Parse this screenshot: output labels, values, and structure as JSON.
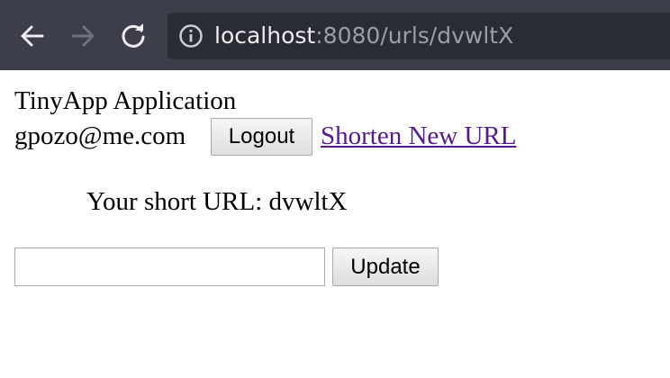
{
  "browser": {
    "url_host": "localhost",
    "url_path": ":8080/urls/dvwltX"
  },
  "page": {
    "title": "TinyApp Application",
    "user_email": "gpozo@me.com",
    "logout_label": "Logout",
    "shorten_link_label": "Shorten New URL",
    "short_url_text": "Your short URL: dvwltX",
    "update_input": {
      "value": "",
      "placeholder": ""
    },
    "update_label": "Update"
  },
  "colors": {
    "toolbar": "#3c3f4a",
    "urlbar": "#2a2c34",
    "visited_link": "#551a8b"
  },
  "icons": {
    "back": "arrow-left-icon",
    "forward": "arrow-right-icon",
    "reload": "reload-icon",
    "info": "info-icon"
  }
}
